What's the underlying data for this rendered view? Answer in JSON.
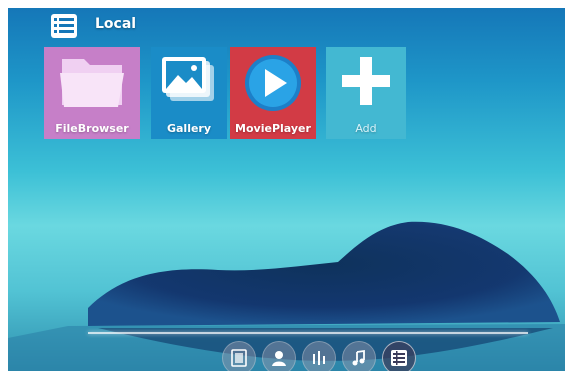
{
  "header": {
    "title": "Local",
    "icon": "list-grid-icon"
  },
  "tiles": [
    {
      "label": "FileBrowser",
      "icon": "folder-icon",
      "color": "#c67fc8"
    },
    {
      "label": "Gallery",
      "icon": "image-stack-icon",
      "color": "#1a8cc7"
    },
    {
      "label": "MoviePlayer",
      "icon": "play-circle-icon",
      "color": "#d23b45"
    },
    {
      "label": "Add",
      "icon": "plus-icon",
      "color": "#43b8d2"
    }
  ],
  "dock": [
    {
      "icon": "film-icon",
      "active": false
    },
    {
      "icon": "person-icon",
      "active": false
    },
    {
      "icon": "equalizer-icon",
      "active": false
    },
    {
      "icon": "music-note-icon",
      "active": false
    },
    {
      "icon": "list-grid-icon",
      "active": true
    }
  ]
}
